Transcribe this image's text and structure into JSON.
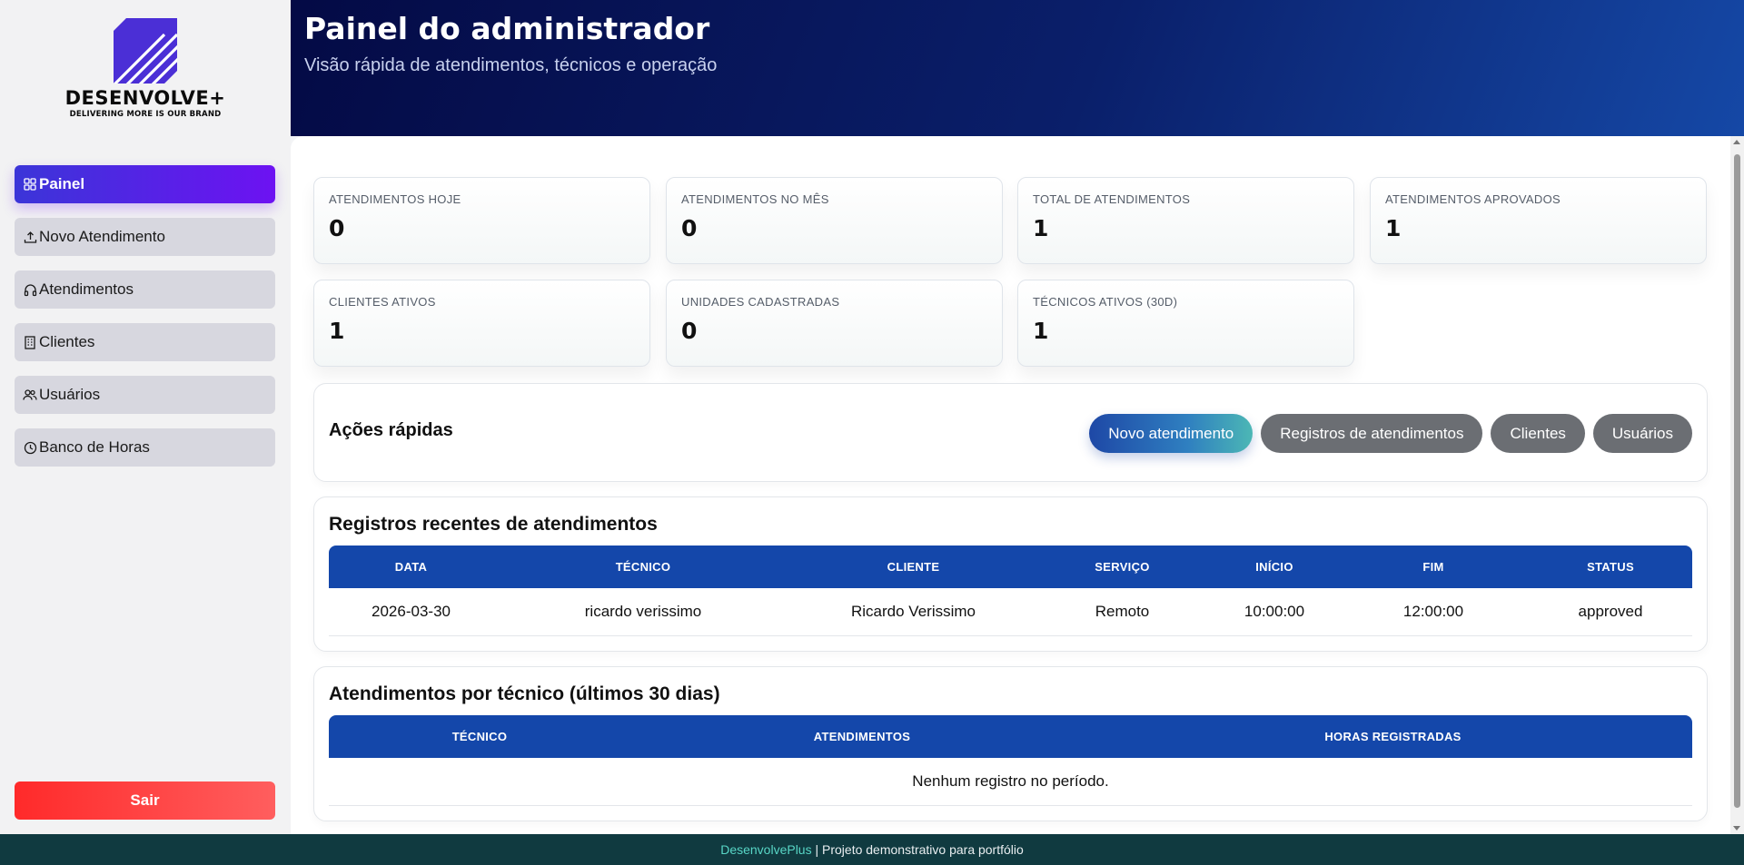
{
  "brand": {
    "name": "DESENVOLVE+",
    "tagline": "DELIVERING MORE IS OUR BRAND",
    "color": "#4b2fd6"
  },
  "sidebar": {
    "items": [
      {
        "label": "Painel",
        "icon": "grid-icon",
        "active": true
      },
      {
        "label": "Novo Atendimento",
        "icon": "upload-icon",
        "active": false
      },
      {
        "label": "Atendimentos",
        "icon": "headphones-icon",
        "active": false
      },
      {
        "label": "Clientes",
        "icon": "building-icon",
        "active": false
      },
      {
        "label": "Usuários",
        "icon": "users-icon",
        "active": false
      },
      {
        "label": "Banco de Horas",
        "icon": "clock-icon",
        "active": false
      }
    ],
    "logout_label": "Sair"
  },
  "header": {
    "title": "Painel do administrador",
    "subtitle": "Visão rápida de atendimentos, técnicos e operação"
  },
  "kpis": [
    {
      "label": "ATENDIMENTOS HOJE",
      "value": "0"
    },
    {
      "label": "ATENDIMENTOS NO MÊS",
      "value": "0"
    },
    {
      "label": "TOTAL DE ATENDIMENTOS",
      "value": "1"
    },
    {
      "label": "ATENDIMENTOS APROVADOS",
      "value": "1"
    },
    {
      "label": "CLIENTES ATIVOS",
      "value": "1"
    },
    {
      "label": "UNIDADES CADASTRADAS",
      "value": "0"
    },
    {
      "label": "TÉCNICOS ATIVOS (30D)",
      "value": "1"
    }
  ],
  "quick_actions": {
    "title": "Ações rápidas",
    "buttons": [
      "Novo atendimento",
      "Registros de atendimentos",
      "Clientes",
      "Usuários"
    ]
  },
  "recent": {
    "title": "Registros recentes de atendimentos",
    "columns": [
      "DATA",
      "TÉCNICO",
      "CLIENTE",
      "SERVIÇO",
      "INÍCIO",
      "FIM",
      "STATUS"
    ],
    "rows": [
      [
        "2026-03-30",
        "ricardo verissimo",
        "Ricardo Verissimo",
        "Remoto",
        "10:00:00",
        "12:00:00",
        "approved"
      ]
    ]
  },
  "by_tech": {
    "title": "Atendimentos por técnico (últimos 30 dias)",
    "columns": [
      "TÉCNICO",
      "ATENDIMENTOS",
      "HORAS REGISTRADAS"
    ],
    "empty": "Nenhum registro no período."
  },
  "footer": {
    "brand": "DesenvolvePlus",
    "text": " | Projeto demonstrativo para portfólio"
  }
}
